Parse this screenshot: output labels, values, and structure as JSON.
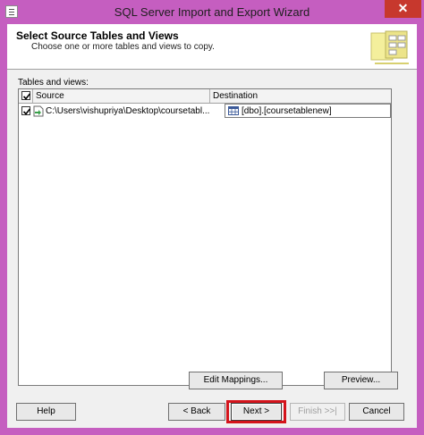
{
  "window": {
    "title": "SQL Server Import and Export Wizard",
    "close_glyph": "✕"
  },
  "header": {
    "title": "Select Source Tables and Views",
    "subtitle": "Choose one or more tables and views to copy."
  },
  "tables": {
    "label": "Tables and views:",
    "columns": {
      "source": "Source",
      "destination": "Destination"
    },
    "rows": [
      {
        "checked": true,
        "source": "C:\\Users\\vishupriya\\Desktop\\coursetabl...",
        "destination": "[dbo].[coursetablenew]"
      }
    ]
  },
  "buttons": {
    "edit_mappings": "Edit Mappings...",
    "preview": "Preview...",
    "help": "Help",
    "back": "< Back",
    "next": "Next >",
    "finish": "Finish >>|",
    "cancel": "Cancel"
  },
  "colors": {
    "window_frame": "#c55ec0",
    "close": "#c7382d",
    "highlight": "#d4141c"
  }
}
